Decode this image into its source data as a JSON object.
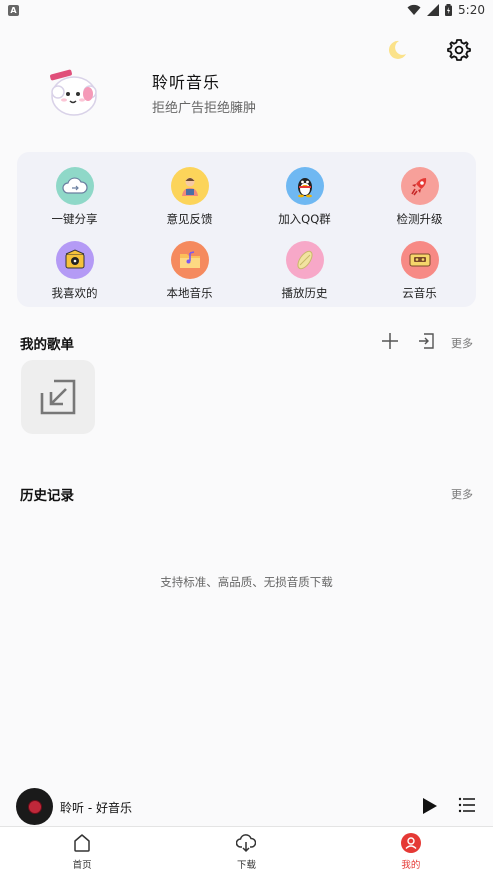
{
  "status_bar": {
    "time": "5:20",
    "left_badge": "A"
  },
  "profile": {
    "name": "聆听音乐",
    "subtitle": "拒绝广告拒绝臃肿"
  },
  "quick_actions": [
    {
      "label": "一键分享",
      "icon": "share-cloud-icon",
      "color": "#8fd8c8"
    },
    {
      "label": "意见反馈",
      "icon": "feedback-person-icon",
      "color": "#fcd45a"
    },
    {
      "label": "加入QQ群",
      "icon": "qq-penguin-icon",
      "color": "#6fb8f2"
    },
    {
      "label": "检测升级",
      "icon": "rocket-icon",
      "color": "#f7a09a"
    },
    {
      "label": "我喜欢的",
      "icon": "liked-music-icon",
      "color": "#b49af5"
    },
    {
      "label": "本地音乐",
      "icon": "local-music-folder-icon",
      "color": "#f58a5e"
    },
    {
      "label": "播放历史",
      "icon": "history-record-icon",
      "color": "#f7a8c8"
    },
    {
      "label": "云音乐",
      "icon": "cloud-cassette-icon",
      "color": "#f78a85"
    }
  ],
  "playlists": {
    "title": "我的歌单",
    "more": "更多"
  },
  "history": {
    "title": "历史记录",
    "more": "更多",
    "empty_text": "支持标准、高品质、无损音质下载"
  },
  "mini_player": {
    "song": "聆听 - 好音乐"
  },
  "tabs": [
    {
      "label": "首页",
      "icon": "home-icon"
    },
    {
      "label": "下载",
      "icon": "cloud-download-icon"
    },
    {
      "label": "我的",
      "icon": "profile-icon",
      "active": true
    }
  ],
  "colors": {
    "accent": "#e53935",
    "card_bg": "#f1f2f8",
    "moon": "#fbe28a"
  }
}
